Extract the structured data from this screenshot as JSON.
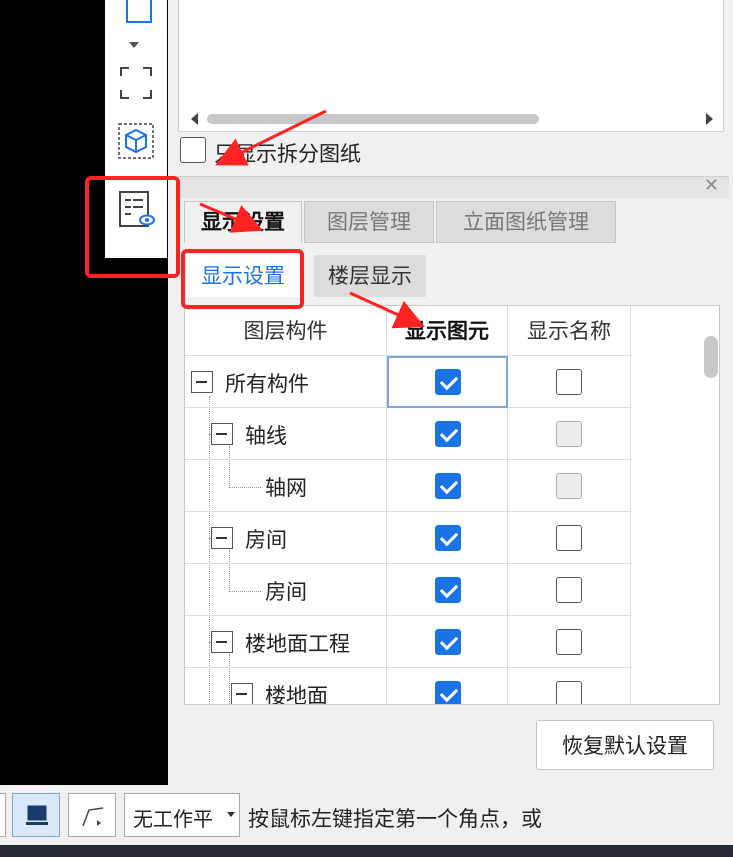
{
  "preview": {
    "split_checkbox_label": "只显示拆分图纸",
    "split_checked": false
  },
  "tabs": [
    {
      "label": "显示设置",
      "active": true
    },
    {
      "label": "图层管理",
      "active": false
    },
    {
      "label": "立面图纸管理",
      "active": false
    }
  ],
  "subtabs": [
    {
      "label": "显示设置",
      "active": true
    },
    {
      "label": "楼层显示",
      "active": false
    }
  ],
  "table": {
    "headers": [
      "图层构件",
      "显示图元",
      "显示名称"
    ],
    "rows": [
      {
        "label": "所有构件",
        "show_element": true,
        "show_name": false,
        "name_disabled": false,
        "collapsible": true
      },
      {
        "label": "轴线",
        "show_element": true,
        "show_name": false,
        "name_disabled": true,
        "collapsible": true
      },
      {
        "label": "轴网",
        "show_element": true,
        "show_name": false,
        "name_disabled": true,
        "collapsible": false
      },
      {
        "label": "房间",
        "show_element": true,
        "show_name": false,
        "name_disabled": false,
        "collapsible": true
      },
      {
        "label": "房间",
        "show_element": true,
        "show_name": false,
        "name_disabled": false,
        "collapsible": false
      },
      {
        "label": "楼地面工程",
        "show_element": true,
        "show_name": false,
        "name_disabled": false,
        "collapsible": true
      },
      {
        "label": "楼地面",
        "show_element": true,
        "show_name": false,
        "name_disabled": false,
        "collapsible": true
      }
    ]
  },
  "reset_button": "恢复默认设置",
  "statusbar": {
    "workplane_select": "无工作平",
    "hint": "按鼠标左键指定第一个角点，或"
  },
  "colors": {
    "accent": "#1a73e8",
    "annotation_red": "#ff2222"
  }
}
